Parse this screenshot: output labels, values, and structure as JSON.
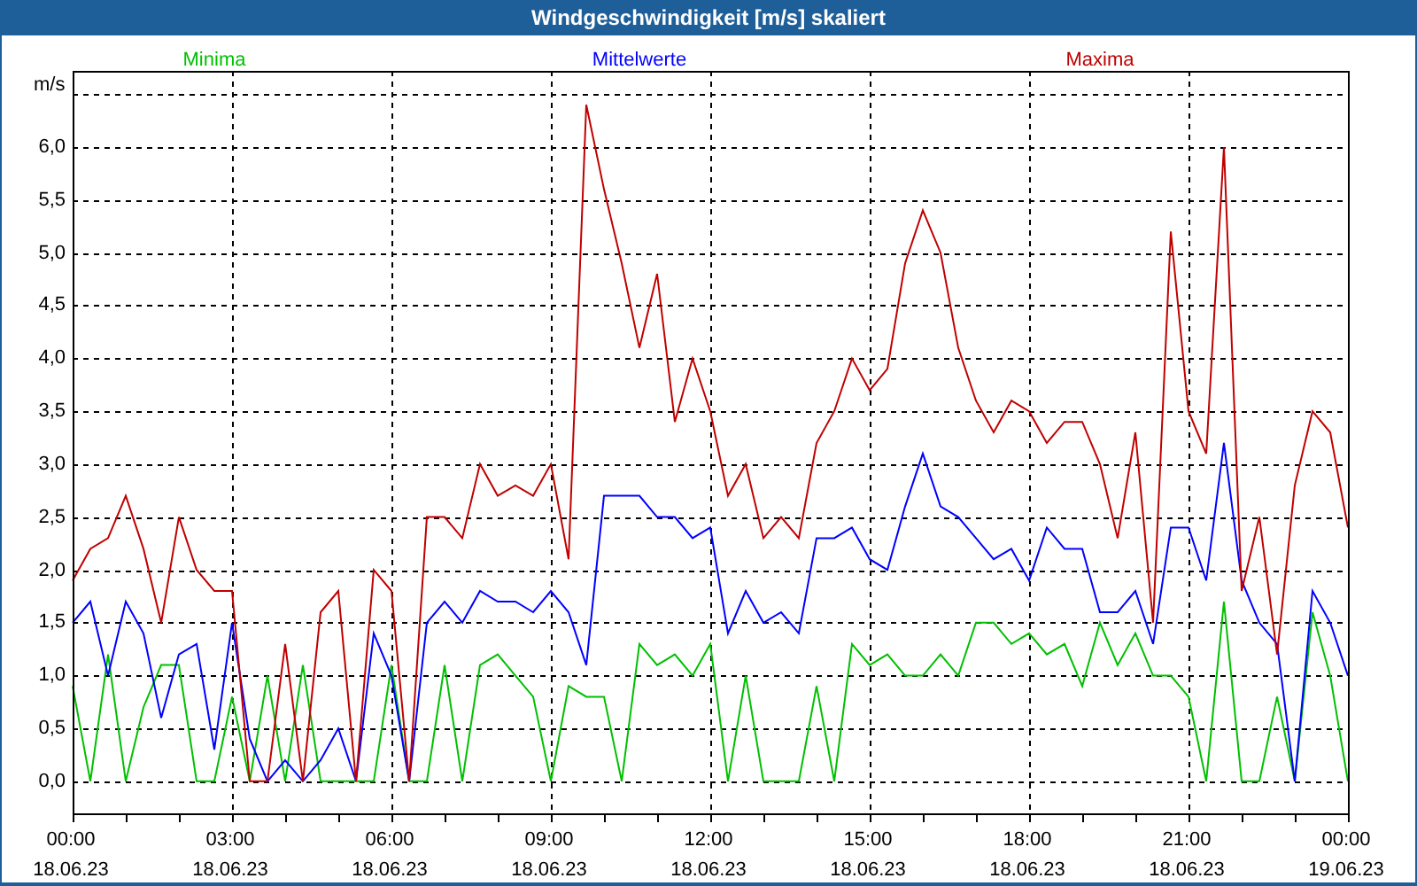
{
  "window": {
    "title": "Windgeschwindigkeit [m/s] skaliert"
  },
  "chart": {
    "chart_data": {
      "type": "line",
      "ylabel": "m/s",
      "categories": [
        "00:00 18.06.23",
        null,
        null,
        null,
        null,
        null,
        null,
        null,
        null,
        "03:00 18.06.23",
        null,
        null,
        null,
        null,
        null,
        null,
        null,
        null,
        "06:00 18.06.23",
        null,
        null,
        null,
        null,
        null,
        null,
        null,
        null,
        "09:00 18.06.23",
        null,
        null,
        null,
        null,
        null,
        null,
        null,
        null,
        "12:00 18.06.23",
        null,
        null,
        null,
        null,
        null,
        null,
        null,
        null,
        "15:00 18.06.23",
        null,
        null,
        null,
        null,
        null,
        null,
        null,
        null,
        "18:00 18.06.23",
        null,
        null,
        null,
        null,
        null,
        null,
        null,
        null,
        "21:00 18.06.23",
        null,
        null,
        null,
        null,
        null,
        null,
        null,
        null,
        "00:00 19.06.23"
      ],
      "series": [
        {
          "name": "Minima",
          "color": "#00c000",
          "values": [
            0.9,
            0,
            1.2,
            0,
            0.7,
            1.1,
            1.1,
            0,
            0,
            0.8,
            0,
            1,
            0,
            1.1,
            0,
            0,
            0,
            0,
            1.1,
            0,
            0,
            1.1,
            0,
            1.1,
            1.2,
            1,
            0.8,
            0,
            0.9,
            0.8,
            0.8,
            0,
            1.3,
            1.1,
            1.2,
            1,
            1.3,
            0,
            1,
            0,
            0,
            0,
            0.9,
            0,
            1.3,
            1.1,
            1.2,
            1,
            1,
            1.2,
            1,
            1.5,
            1.5,
            1.3,
            1.4,
            1.2,
            1.3,
            0.9,
            1.5,
            1.1,
            1.4,
            1,
            1,
            0.8,
            0,
            1.7,
            0,
            0,
            0.8,
            0,
            1.6,
            1,
            0
          ]
        },
        {
          "name": "Mittelwerte",
          "color": "#0000ff",
          "values": [
            1.5,
            1.7,
            1,
            1.7,
            1.4,
            0.6,
            1.2,
            1.3,
            0.3,
            1.5,
            0.4,
            0,
            0.2,
            0,
            0.2,
            0.5,
            0,
            1.4,
            1,
            0,
            1.5,
            1.7,
            1.5,
            1.8,
            1.7,
            1.7,
            1.6,
            1.8,
            1.6,
            1.1,
            2.7,
            2.7,
            2.7,
            2.5,
            2.5,
            2.3,
            2.4,
            1.4,
            1.8,
            1.5,
            1.6,
            1.4,
            2.3,
            2.3,
            2.4,
            2.1,
            2,
            2.6,
            3.1,
            2.6,
            2.5,
            2.3,
            2.1,
            2.2,
            1.9,
            2.4,
            2.2,
            2.2,
            1.6,
            1.6,
            1.8,
            1.3,
            2.4,
            2.4,
            1.9,
            3.2,
            1.9,
            1.5,
            1.3,
            0,
            1.8,
            1.5,
            1
          ]
        },
        {
          "name": "Maxima",
          "color": "#c00000",
          "values": [
            1.9,
            2.2,
            2.3,
            2.7,
            2.2,
            1.5,
            2.5,
            2,
            1.8,
            1.8,
            0,
            0,
            1.3,
            0,
            1.6,
            1.8,
            0,
            2,
            1.8,
            0,
            2.5,
            2.5,
            2.3,
            3,
            2.7,
            2.8,
            2.7,
            3,
            2.1,
            6.4,
            5.6,
            4.9,
            4.1,
            4.8,
            3.4,
            4,
            3.5,
            2.7,
            3,
            2.3,
            2.5,
            2.3,
            3.2,
            3.5,
            4,
            3.7,
            3.9,
            4.9,
            5.4,
            5,
            4.1,
            3.6,
            3.3,
            3.6,
            3.5,
            3.2,
            3.4,
            3.4,
            3,
            2.3,
            3.3,
            1.5,
            5.2,
            3.5,
            3.1,
            6,
            1.8,
            2.5,
            1.2,
            2.8,
            3.5,
            3.3,
            2.4
          ]
        }
      ],
      "ylim": [
        -0.32,
        6.72
      ],
      "grid": true,
      "yticks": [
        {
          "value": 0,
          "label": "0,0"
        },
        {
          "value": 0.5,
          "label": "0,5"
        },
        {
          "value": 1,
          "label": "1,0"
        },
        {
          "value": 1.5,
          "label": "1,5"
        },
        {
          "value": 2,
          "label": "2,0"
        },
        {
          "value": 2.5,
          "label": "2,5"
        },
        {
          "value": 3,
          "label": "3,0"
        },
        {
          "value": 3.5,
          "label": "3,5"
        },
        {
          "value": 4,
          "label": "4,0"
        },
        {
          "value": 4.5,
          "label": "4,5"
        },
        {
          "value": 5,
          "label": "5,0"
        },
        {
          "value": 5.5,
          "label": "5,5"
        },
        {
          "value": 6,
          "label": "6,0"
        }
      ]
    }
  }
}
